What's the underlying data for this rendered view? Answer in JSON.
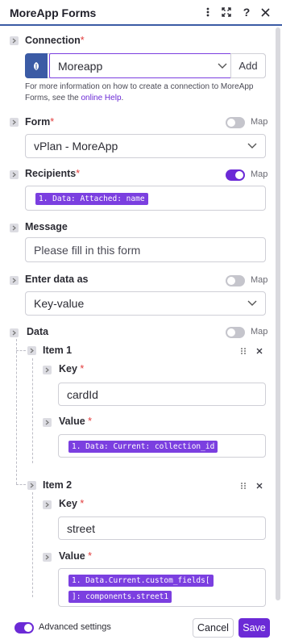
{
  "header": {
    "title": "MoreApp Forms"
  },
  "connection": {
    "label": "Connection",
    "required": "*",
    "selected": "Moreapp",
    "add_label": "Add",
    "help_text": "For more information on how to create a connection to MoreApp Forms, see the ",
    "help_link": "online Help",
    "help_end": "."
  },
  "form": {
    "label": "Form",
    "required": "*",
    "map_label": "Map",
    "map_on": false,
    "selected": "vPlan - MoreApp"
  },
  "recipients": {
    "label": "Recipients",
    "required": "*",
    "map_label": "Map",
    "map_on": true,
    "token": "1. Data: Attached: name"
  },
  "message": {
    "label": "Message",
    "placeholder": "Please fill in this form"
  },
  "enter_data": {
    "label": "Enter data as",
    "map_label": "Map",
    "map_on": false,
    "selected": "Key-value"
  },
  "data": {
    "label": "Data",
    "map_label": "Map",
    "map_on": false,
    "items": [
      {
        "title": "Item 1",
        "key_label": "Key",
        "key_value": "cardId",
        "value_label": "Value",
        "value_tokens": [
          "1. Data: Current: collection_id"
        ]
      },
      {
        "title": "Item 2",
        "key_label": "Key",
        "key_value": "street",
        "value_label": "Value",
        "value_tokens": [
          "1. Data.Current.custom_fields[",
          "]: components.street1"
        ]
      }
    ]
  },
  "footer": {
    "advanced_label": "Advanced settings",
    "advanced_on": true,
    "cancel_label": "Cancel",
    "save_label": "Save"
  },
  "colors": {
    "accent": "#6b2ad6",
    "token": "#7b3fe0",
    "header_line": "#3b5ba5",
    "required": "#e23b3b"
  }
}
